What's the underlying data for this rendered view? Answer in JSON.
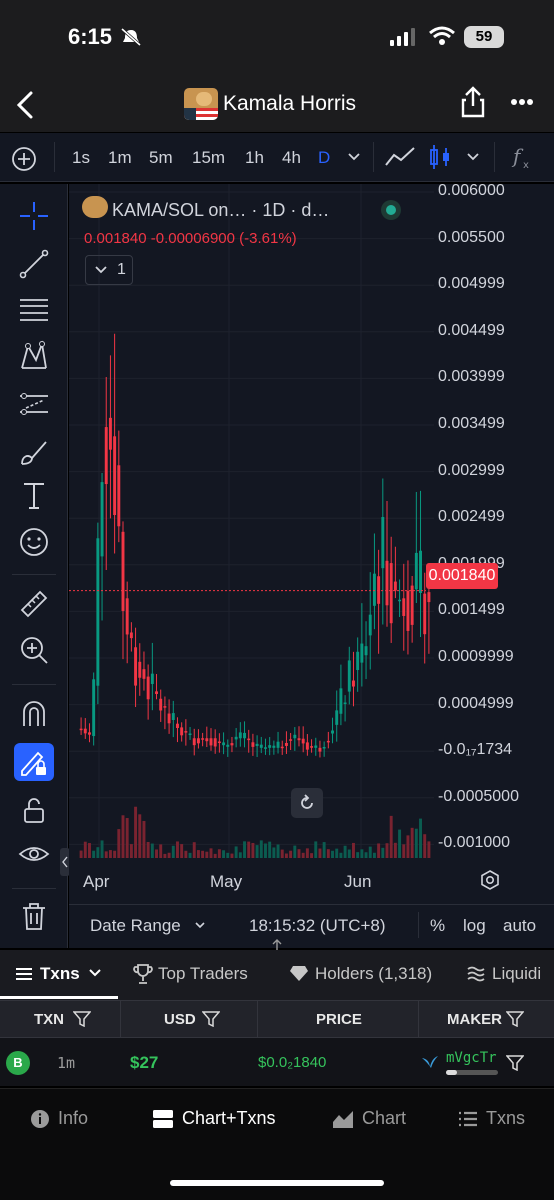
{
  "status": {
    "time": "6:15",
    "battery": "59"
  },
  "nav": {
    "title": "Kamala Horris"
  },
  "toolbar": {
    "timeframes": [
      "1s",
      "1m",
      "5m",
      "15m",
      "1h",
      "4h",
      "D"
    ],
    "active_timeframe": "D"
  },
  "legend": {
    "pair": "KAMA/SOL on…  · 1D · d…",
    "ohlc": "0.001840  -0.00006900 (-3.61%)",
    "indicator_count": "1"
  },
  "price_axis": {
    "labels": [
      "0.006000",
      "0.005500",
      "0.004999",
      "0.004499",
      "0.003999",
      "0.003499",
      "0.002999",
      "0.002499",
      "0.001999",
      "0.001499",
      "0.0009999",
      "0.0004999",
      "-0.0₁₇1734",
      "-0.0005000",
      "-0.001000"
    ],
    "current_price": "0.001840"
  },
  "time_axis": {
    "labels": [
      "Apr",
      "May",
      "Jun"
    ]
  },
  "chart_bottom": {
    "date_range": "Date Range",
    "clock": "18:15:32 (UTC+8)",
    "percent": "%",
    "log": "log",
    "auto": "auto"
  },
  "chart_data": {
    "type": "candlestick",
    "x_labels": [
      "Apr",
      "May",
      "Jun"
    ],
    "ylim": [
      -0.0012,
      0.006
    ],
    "last_price": 0.00184,
    "change": -6.9e-05,
    "change_pct": -3.61,
    "trend": [
      0.0004,
      0.0003,
      0.0038,
      0.0033,
      0.0015,
      0.0011,
      0.0009,
      0.0007,
      0.0005,
      0.0004,
      0.0003,
      0.0003,
      0.0003,
      0.0002,
      0.0003,
      0.0003,
      0.0002,
      0.0002,
      0.0002,
      0.0003,
      0.0003,
      0.0002,
      0.0002,
      0.0004,
      0.0007,
      0.001,
      0.0012,
      0.002,
      0.0022,
      0.0017,
      0.0019,
      0.0018,
      0.00184
    ]
  },
  "txn_tabs": {
    "txns": "Txns",
    "top_traders": "Top Traders",
    "holders": "Holders (1,318)",
    "liquidity": "Liquidi"
  },
  "table": {
    "headers": [
      "TXN",
      "USD",
      "PRICE",
      "MAKER"
    ],
    "rows": [
      {
        "type": "B",
        "time": "1m",
        "usd": "$27",
        "price": "$0.0₂1840",
        "maker": "mVgcTr"
      }
    ]
  },
  "bottom_nav": {
    "info": "Info",
    "chart_txns": "Chart+Txns",
    "chart": "Chart",
    "txns": "Txns"
  },
  "colors": {
    "up": "#089981",
    "down": "#f23645",
    "accent": "#2962ff",
    "background": "#131722"
  }
}
